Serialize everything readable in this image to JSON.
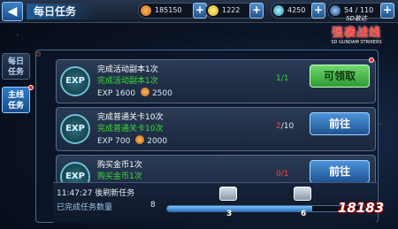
{
  "header": {
    "title": "每日任务",
    "currency_1": "185150",
    "currency_2": "1222",
    "currency_3": "4250",
    "currency_4": "54 / 110"
  },
  "logo": {
    "top": "SD敢达",
    "main": "强袭战线",
    "sub": "SD GUNDAM STRIKERS"
  },
  "sidebar": {
    "daily": "每日任务",
    "main": "主线任务"
  },
  "tasks": [
    {
      "icon": "EXP",
      "name": "完成活动副本1次",
      "sub": "完成活动副本1次",
      "progress": "1/1",
      "exp_label": "EXP",
      "exp": "1600",
      "coins": "2500",
      "button": "可领取"
    },
    {
      "icon": "EXP",
      "name": "完成普通关卡10次",
      "sub": "完成普通关卡10次",
      "progress_done": "2",
      "progress_total": "/10",
      "exp_label": "EXP",
      "exp": "700",
      "coins": "2000",
      "button": "前往"
    },
    {
      "icon": "EXP",
      "name": "购买金币1次",
      "sub": "购买金币1次",
      "progress": "0/1",
      "button": "前往"
    }
  ],
  "bottom": {
    "refresh": "11:47:27 後刷新任务",
    "completed_label": "已完成任务数量",
    "completed_count": "8",
    "milestone_1": "3",
    "milestone_2": "6",
    "progress_fraction": 0.73
  },
  "watermark": "18183",
  "colors": {
    "accent_blue": "#2f7cc8",
    "claim_green": "#2f9a35",
    "progress_red": "#ff4040",
    "task_green": "#3cdc3c"
  }
}
